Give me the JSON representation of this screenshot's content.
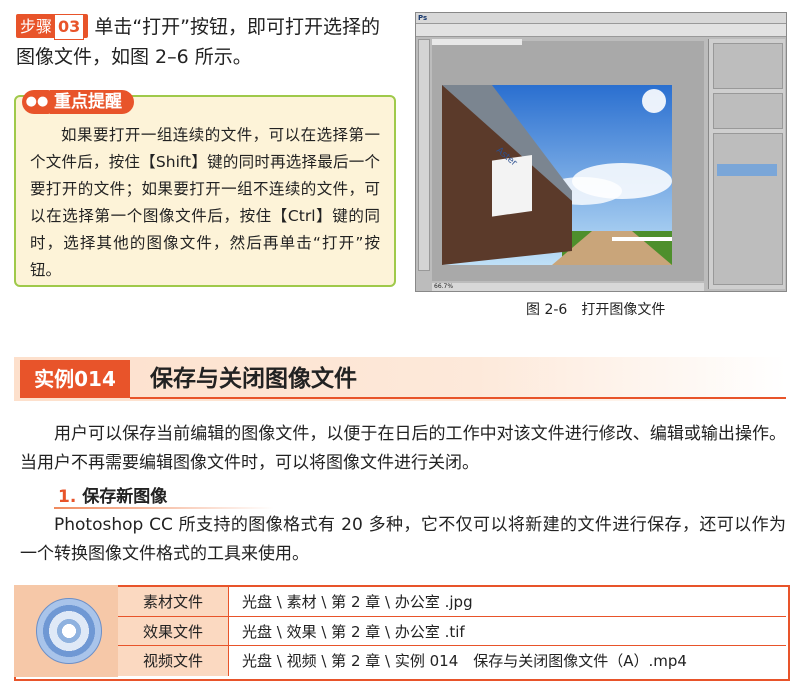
{
  "step": {
    "badge": "步骤",
    "number": "03",
    "text": "单击“打开”按钮，即可打开选择的图像文件，如图 2–6 所示。"
  },
  "tip": {
    "title": "重点提醒",
    "body": "如果要打开一组连续的文件，可以在选择第一个文件后，按住【Shift】键的同时再选择最后一个要打开的文件；如果要打开一组不连续的文件，可以在选择第一个图像文件后，按住【Ctrl】键的同时，选择其他的图像文件，然后再单击“打开”按钮。"
  },
  "figure": {
    "caption": "图 2-6　打开图像文件",
    "ps_logo": "Ps",
    "status_zoom": "66.7%"
  },
  "section": {
    "tag": "实例014",
    "title": "保存与关闭图像文件"
  },
  "paragraph1": "用户可以保存当前编辑的图像文件，以便于在日后的工作中对该文件进行修改、编辑或输出操作。当用户不再需要编辑图像文件时，可以将图像文件进行关闭。",
  "subsection": {
    "num": "1.",
    "title": "保存新图像"
  },
  "paragraph2": "Photoshop CC 所支持的图像格式有 20 多种，它不仅可以将新建的文件进行保存，还可以作为一个转换图像文件格式的工具来使用。",
  "files": [
    {
      "label": "素材文件",
      "value": "光盘 \\ 素材 \\ 第 2 章 \\ 办公室 .jpg"
    },
    {
      "label": "效果文件",
      "value": "光盘 \\ 效果 \\ 第 2 章 \\ 办公室 .tif"
    },
    {
      "label": "视频文件",
      "value": "光盘 \\ 视频 \\ 第 2 章 \\ 实例 014　保存与关闭图像文件（A）.mp4"
    }
  ]
}
